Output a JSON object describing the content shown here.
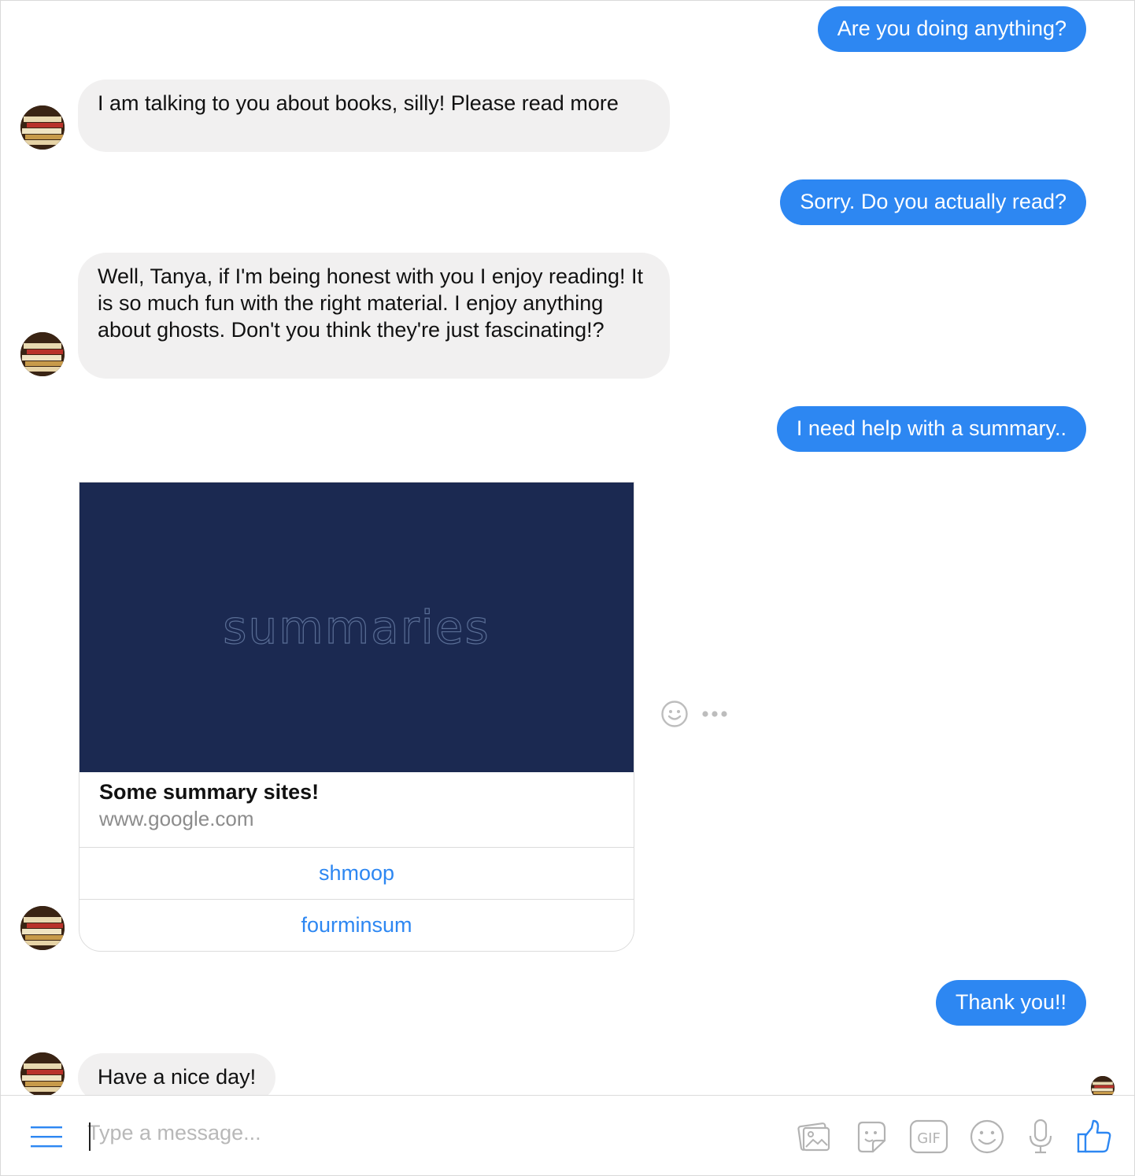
{
  "messages": [
    {
      "side": "out",
      "text": "Are you doing anything?"
    },
    {
      "side": "in",
      "text": "I am talking to you about books, silly! Please read more"
    },
    {
      "side": "out",
      "text": "Sorry. Do you actually read?"
    },
    {
      "side": "in",
      "text": "Well, Tanya, if I'm being honest with you I enjoy reading! It is so much fun with the right material. I enjoy anything about ghosts. Don't you think they're just fascinating!?"
    },
    {
      "side": "out",
      "text": "I need help with a summary.."
    },
    {
      "side": "out",
      "text": "Thank you!!"
    },
    {
      "side": "in",
      "text": "Have a nice day!"
    }
  ],
  "card": {
    "image_text": "summaries",
    "title": "Some summary sites!",
    "subtitle": "www.google.com",
    "buttons": [
      "shmoop",
      "fourminsum"
    ]
  },
  "composer": {
    "placeholder": "Type a message...",
    "tools": [
      "menu-icon",
      "photo-icon",
      "sticker-icon",
      "gif-icon",
      "emoji-icon",
      "microphone-icon",
      "thumbs-up-icon"
    ],
    "gif_label": "GIF"
  },
  "colors": {
    "outgoing": "#2d87f2",
    "incoming": "#f1f0f0",
    "card_image": "#1b2951",
    "link": "#2d87f2"
  }
}
